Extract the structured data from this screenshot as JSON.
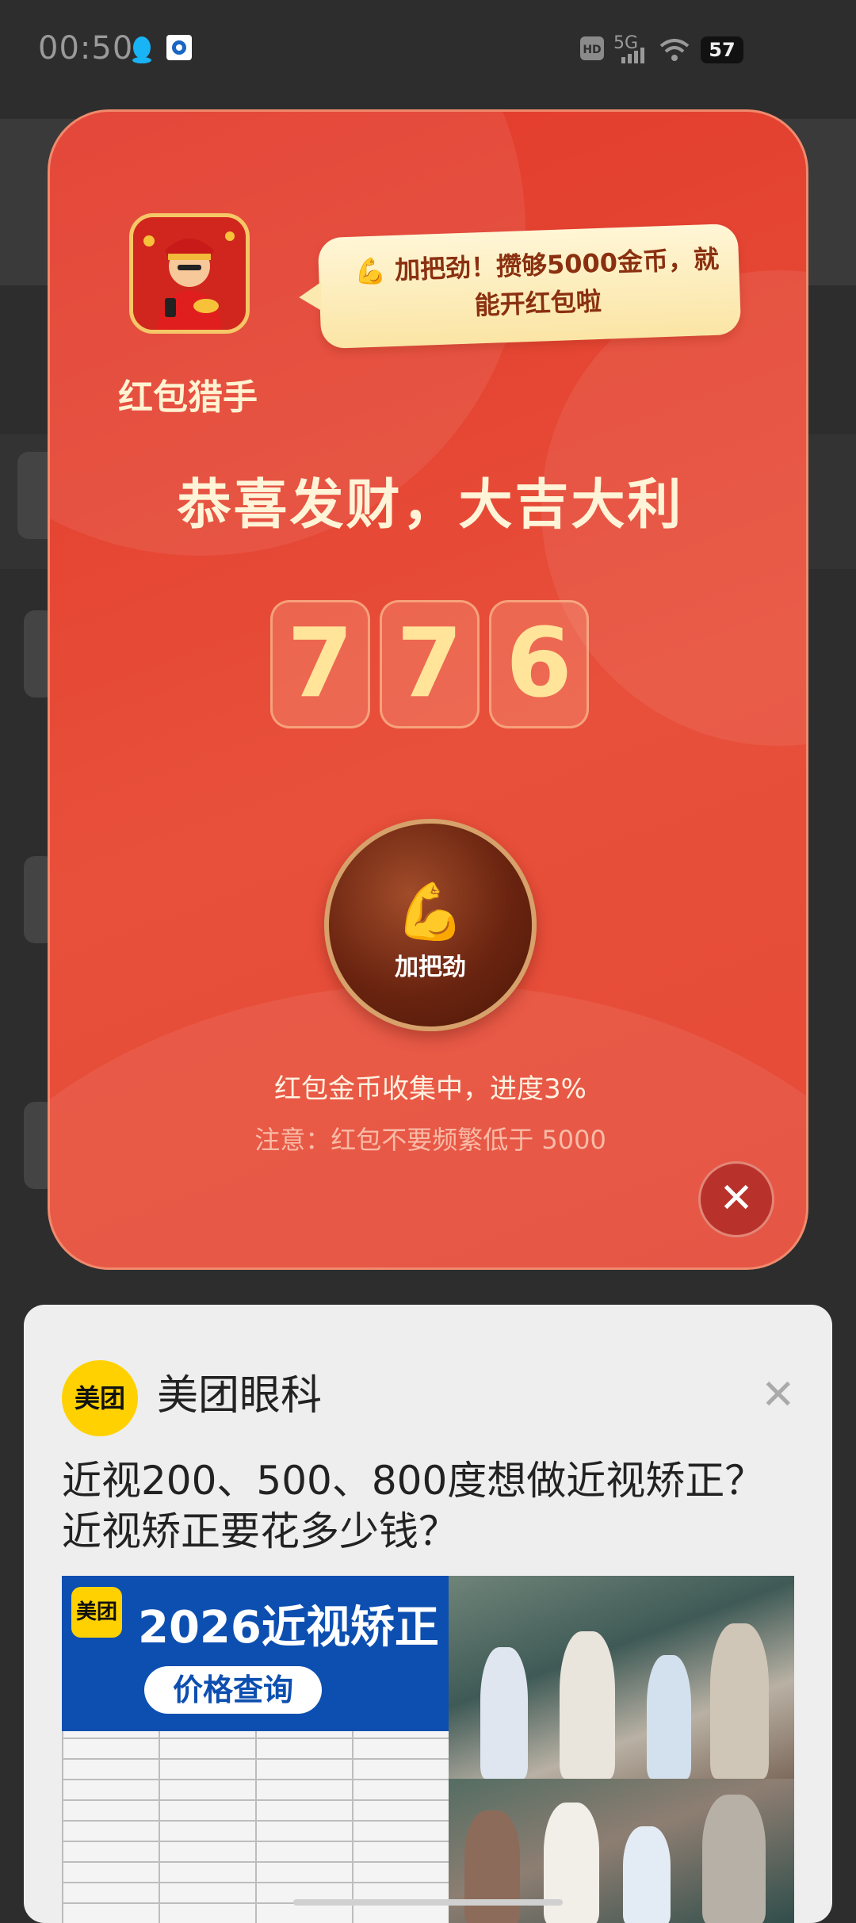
{
  "status_bar": {
    "time": "00:50",
    "network": "5G",
    "hd": "HD",
    "battery": "57",
    "left_icons": [
      "qq-icon",
      "app-icon"
    ],
    "right_icons": [
      "hd-icon",
      "signal-icon",
      "wifi-icon",
      "battery-icon"
    ]
  },
  "dialog": {
    "app_name": "红包猎手",
    "bubble_text": "💪 加把劲！攒够5000金币，就能开红包啦",
    "headline": "恭喜发财，大吉大利",
    "digits": [
      "7",
      "7",
      "6"
    ],
    "cheer_emoji": "💪",
    "cheer_label": "加把劲",
    "progress_text": "红包金币收集中，进度3%",
    "progress": 0.03,
    "note_text": "注意：红包不要频繁低于 5000",
    "close_symbol": "✕",
    "colors": {
      "primary": "#e5473a",
      "gold": "#ffe49a",
      "button": "#6a2410"
    }
  },
  "ad": {
    "logo_text": "美团",
    "brand": "美团眼科",
    "close_symbol": "✕",
    "title": "近视200、500、800度想做近视矫正？近视矫正要花多少钱？",
    "banner": {
      "logo_text": "美团",
      "heading": "2026近视矫正",
      "pill": "价格查询"
    },
    "colors": {
      "brand_yellow": "#ffd100",
      "banner_blue": "#0d4fb0"
    }
  }
}
